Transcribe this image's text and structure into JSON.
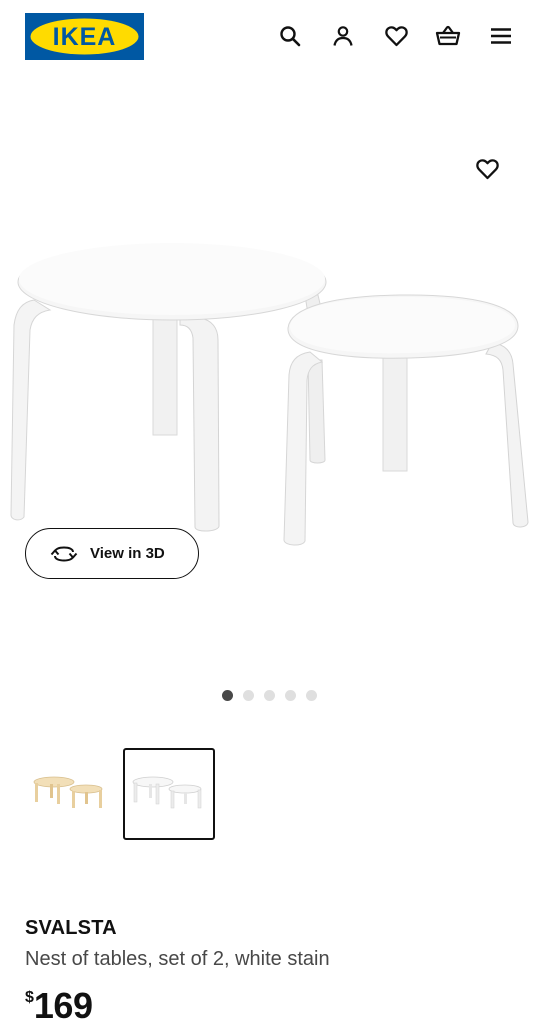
{
  "header": {
    "logo_text": "IKEA",
    "icons": [
      "search-icon",
      "account-icon",
      "heart-icon",
      "basket-icon",
      "menu-icon"
    ]
  },
  "gallery": {
    "favorite_icon": "heart-icon",
    "view3d_label": "View in 3D",
    "view3d_icon": "rotate-3d-icon",
    "dots_count": 5,
    "active_dot": 1
  },
  "thumbnails": [
    {
      "variant": "birch"
    },
    {
      "variant": "white stain",
      "selected": true
    }
  ],
  "product": {
    "name": "SVALSTA",
    "description": "Nest of tables, set of 2, white stain",
    "price_currency": "$",
    "price_amount": "169"
  },
  "colors": {
    "brand_blue": "#0058a3",
    "brand_yellow": "#ffdb00",
    "text": "#111111",
    "muted_text": "#484848"
  }
}
